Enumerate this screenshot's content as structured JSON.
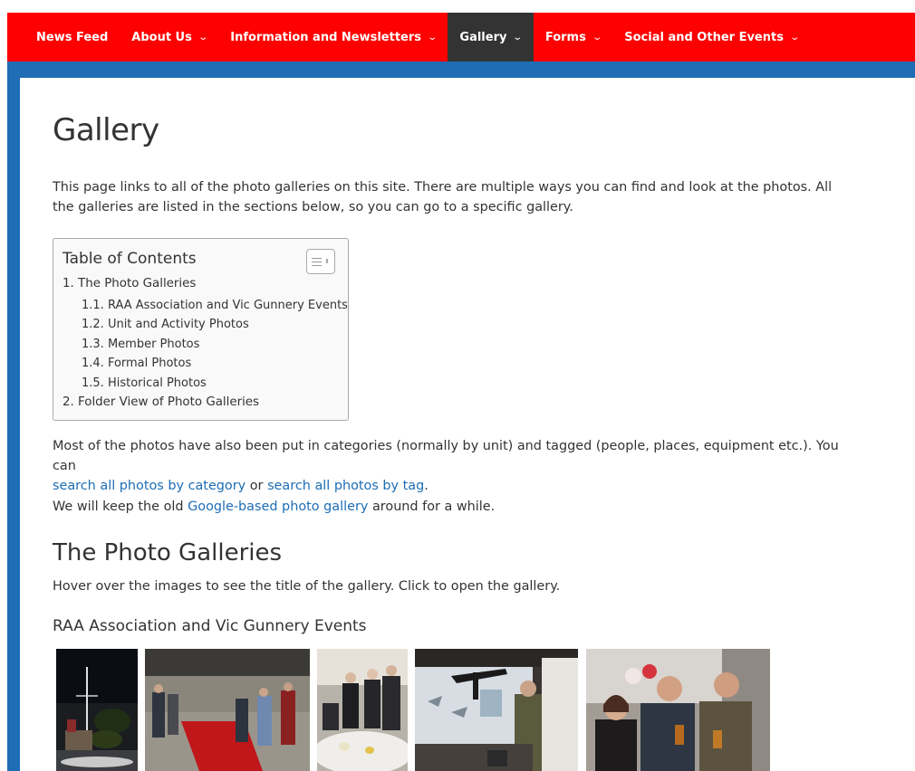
{
  "nav": {
    "items": [
      {
        "label": "News Feed",
        "dropdown": false
      },
      {
        "label": "About Us",
        "dropdown": true
      },
      {
        "label": "Information and Newsletters",
        "dropdown": true
      },
      {
        "label": "Gallery",
        "dropdown": true,
        "active": true
      },
      {
        "label": "Forms",
        "dropdown": true
      },
      {
        "label": "Social and Other Events",
        "dropdown": true
      }
    ],
    "chevron": "⌄"
  },
  "page": {
    "title": "Gallery",
    "intro": "This page links to all of the photo galleries on this site. There are multiple ways you can find and look at the photos. All the galleries are listed in the sections below, so you can go to a specific gallery.",
    "categories_text_1": "Most of the photos have also been put in categories (normally by unit) and tagged (people, places, equipment etc.). You can",
    "link_category": "search all photos by category",
    "categories_text_2": "or",
    "link_tag": "search all photos by tag",
    "categories_text_3": ".",
    "google_text_1": "We will keep the old",
    "link_google": "Google-based photo gallery",
    "google_text_2": "around for a while."
  },
  "toc": {
    "title": "Table of Contents",
    "items": [
      "1. The Photo Galleries",
      "1.1. RAA Association and Vic Gunnery Events",
      "1.2. Unit and Activity Photos",
      "1.3. Member Photos",
      "1.4. Formal Photos",
      "1.5. Historical Photos",
      "2. Folder View of Photo Galleries"
    ]
  },
  "section": {
    "heading": "The Photo Galleries",
    "hint": "Hover over the images to see the title of the gallery. Click to open the gallery.",
    "subheading": "RAA Association and Vic Gunnery Events"
  },
  "colors": {
    "nav_bg": "#fe0000",
    "nav_active": "#333333",
    "frame_blue": "#1e6db5",
    "link": "#1e6db5"
  }
}
